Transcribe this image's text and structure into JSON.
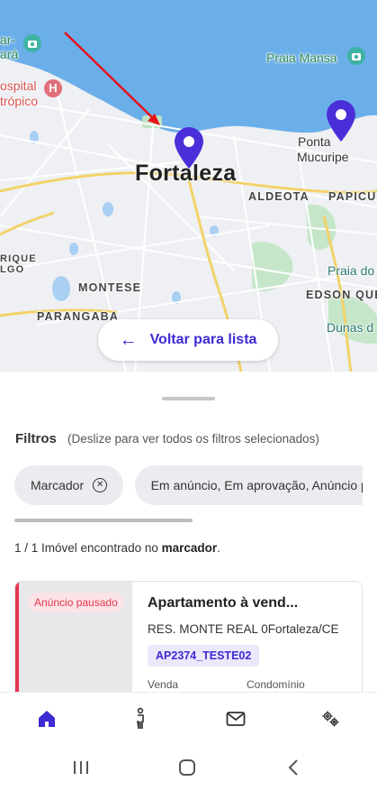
{
  "map": {
    "labels": {
      "city": "Fortaleza",
      "aldeota": "ALDEOTA",
      "papicu": "PAPICU",
      "montese": "MONTESE",
      "parangaba": "PARANGABA",
      "edson_queiroz": "EDSON QUE",
      "rique": "RIQUE",
      "lgo": "LGO",
      "praia_mansa": "Praia Mansa",
      "ponta_line1": "Ponta",
      "ponta_line2": "Mucuripe",
      "hospital_line1": "ospital",
      "hospital_line2": "trópico",
      "praia_iracema_line1": "ar-",
      "praia_iracema_line2": "ará",
      "praia_do": "Praia do",
      "dunas": "Dunas d"
    },
    "back_button_label": "Voltar para lista"
  },
  "filters": {
    "title": "Filtros",
    "hint": "(Deslize para ver todos os filtros selecionados)",
    "chips": [
      "Marcador",
      "Em anúncio, Em aprovação, Anúncio pausado"
    ]
  },
  "results": {
    "count_prefix": "1 / 1 Imóvel encontrado no ",
    "count_bold": "marcador",
    "count_suffix": "."
  },
  "listing": {
    "status_badge": "Anúncio pausado",
    "title": "Apartamento à vend...",
    "address": "RES. MONTE REAL 0Fortaleza/CE",
    "code": "AP2374_TESTE02",
    "label_sale": "Venda",
    "label_condo": "Condomínio"
  },
  "colors": {
    "accent": "#3d2bd4",
    "paused": "#e53950",
    "sea": "#6aaeea",
    "pin": "#4a2fd9"
  },
  "tabs": [
    "home-icon",
    "person-icon",
    "mail-icon",
    "settings-icon"
  ],
  "system_nav": [
    "recent-apps-icon",
    "home-circle-icon",
    "back-chevron-icon"
  ]
}
